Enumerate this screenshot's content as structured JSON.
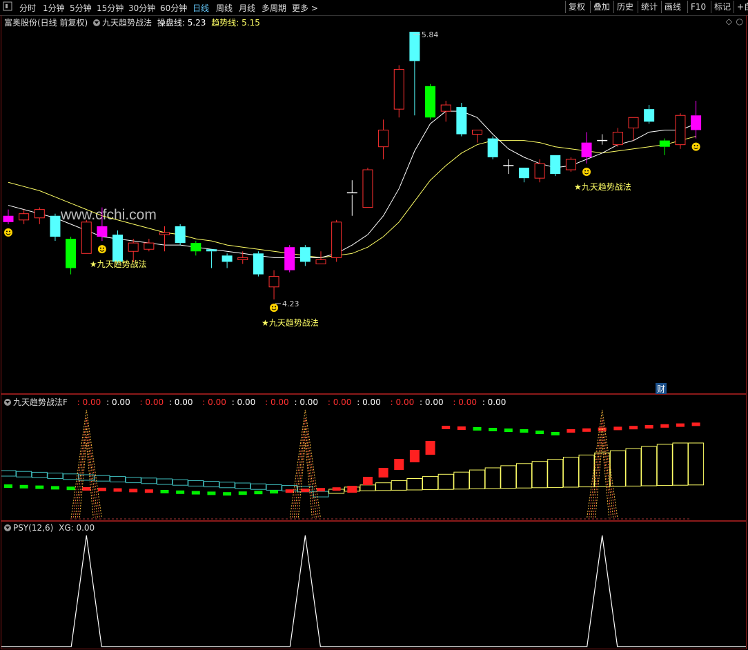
{
  "toolbar": {
    "menu_icon": "menu-icon",
    "periods": [
      "分时",
      "1分钟",
      "5分钟",
      "15分钟",
      "30分钟",
      "60分钟",
      "日线",
      "周线",
      "月线",
      "多周期",
      "更多 >"
    ],
    "active_period": "日线",
    "buttons": [
      "复权",
      "叠加",
      "历史",
      "统计",
      "画线",
      "F10",
      "标记",
      "+自"
    ]
  },
  "main_panel": {
    "title_stock": "富奥股份(日线 前复权)",
    "indicator_name": "九天趋势战法",
    "line1_label": "操盘线: 5.23",
    "line2_label": "趋势线: 5.15",
    "watermark": "www.cfchi.com",
    "high_marker": "5.84",
    "low_marker": "4.23",
    "signal_text": "★九天趋势战法",
    "cai_badge": "财",
    "colors": {
      "up_solid": "#ff00ff",
      "up_hollow": "#ff3030",
      "down_solid": "#00ff00",
      "down_cyan": "#55ffff",
      "ma_white": "#ffffff",
      "ma_yellow": "#ffff66"
    }
  },
  "sub1": {
    "title": "九天趋势战法F",
    "values": [
      "0.00",
      "0.00",
      "0.00",
      "0.00",
      "0.00",
      "0.00",
      "0.00",
      "0.00",
      "0.00",
      "0.00",
      "0.00",
      "0.00",
      "0.00",
      "0.00"
    ]
  },
  "sub2": {
    "title": "PSY(12,6)",
    "xg_label": "XG: 0.00"
  },
  "chart_data": {
    "type": "candlestick",
    "price_range": [
      4.23,
      5.84
    ],
    "candles": [
      {
        "o": 4.96,
        "c": 4.93,
        "h": 4.99,
        "l": 4.92,
        "k": "m"
      },
      {
        "o": 4.94,
        "c": 4.97,
        "h": 4.99,
        "l": 4.92,
        "k": "r"
      },
      {
        "o": 4.95,
        "c": 4.99,
        "h": 5.0,
        "l": 4.92,
        "k": "r"
      },
      {
        "o": 4.96,
        "c": 4.86,
        "h": 4.97,
        "l": 4.84,
        "k": "c"
      },
      {
        "o": 4.85,
        "c": 4.71,
        "h": 4.86,
        "l": 4.68,
        "k": "g"
      },
      {
        "o": 4.78,
        "c": 4.93,
        "h": 4.94,
        "l": 4.78,
        "k": "r"
      },
      {
        "o": 4.91,
        "c": 4.86,
        "h": 5.0,
        "l": 4.84,
        "k": "m"
      },
      {
        "o": 4.87,
        "c": 4.74,
        "h": 4.89,
        "l": 4.73,
        "k": "c"
      },
      {
        "o": 4.79,
        "c": 4.83,
        "h": 4.85,
        "l": 4.74,
        "k": "r"
      },
      {
        "o": 4.8,
        "c": 4.83,
        "h": 4.85,
        "l": 4.79,
        "k": "r"
      },
      {
        "o": 4.87,
        "c": 4.88,
        "h": 4.91,
        "l": 4.79,
        "k": "r"
      },
      {
        "o": 4.91,
        "c": 4.83,
        "h": 4.92,
        "l": 4.82,
        "k": "c"
      },
      {
        "o": 4.83,
        "c": 4.79,
        "h": 4.84,
        "l": 4.77,
        "k": "g"
      },
      {
        "o": 4.8,
        "c": 4.79,
        "h": 4.8,
        "l": 4.71,
        "k": "c"
      },
      {
        "o": 4.77,
        "c": 4.74,
        "h": 4.78,
        "l": 4.71,
        "k": "c"
      },
      {
        "o": 4.75,
        "c": 4.76,
        "h": 4.79,
        "l": 4.73,
        "k": "r"
      },
      {
        "o": 4.78,
        "c": 4.68,
        "h": 4.79,
        "l": 4.67,
        "k": "c"
      },
      {
        "o": 4.62,
        "c": 4.67,
        "h": 4.7,
        "l": 4.56,
        "k": "r"
      },
      {
        "o": 4.7,
        "c": 4.81,
        "h": 4.82,
        "l": 4.69,
        "k": "m"
      },
      {
        "o": 4.81,
        "c": 4.74,
        "h": 4.82,
        "l": 4.72,
        "k": "c"
      },
      {
        "o": 4.73,
        "c": 4.75,
        "h": 4.79,
        "l": 4.73,
        "k": "r"
      },
      {
        "o": 4.76,
        "c": 4.93,
        "h": 4.94,
        "l": 4.74,
        "k": "r"
      },
      {
        "o": 5.06,
        "c": 5.07,
        "h": 5.13,
        "l": 4.96,
        "k": "w"
      },
      {
        "o": 5.0,
        "c": 5.18,
        "h": 5.19,
        "l": 5.0,
        "k": "r"
      },
      {
        "o": 5.29,
        "c": 5.37,
        "h": 5.42,
        "l": 5.23,
        "k": "r"
      },
      {
        "o": 5.47,
        "c": 5.66,
        "h": 5.68,
        "l": 5.43,
        "k": "r"
      },
      {
        "o": 5.7,
        "c": 5.84,
        "h": 5.84,
        "l": 5.44,
        "k": "c"
      },
      {
        "o": 5.58,
        "c": 5.43,
        "h": 5.59,
        "l": 5.42,
        "k": "g"
      },
      {
        "o": 5.46,
        "c": 5.49,
        "h": 5.51,
        "l": 5.41,
        "k": "r"
      },
      {
        "o": 5.48,
        "c": 5.35,
        "h": 5.5,
        "l": 5.34,
        "k": "c"
      },
      {
        "o": 5.35,
        "c": 5.37,
        "h": 5.37,
        "l": 5.31,
        "k": "r"
      },
      {
        "o": 5.33,
        "c": 5.24,
        "h": 5.34,
        "l": 5.23,
        "k": "c"
      },
      {
        "o": 5.2,
        "c": 5.2,
        "h": 5.23,
        "l": 5.16,
        "k": "w"
      },
      {
        "o": 5.19,
        "c": 5.14,
        "h": 5.19,
        "l": 5.12,
        "k": "c"
      },
      {
        "o": 5.14,
        "c": 5.21,
        "h": 5.23,
        "l": 5.12,
        "k": "r"
      },
      {
        "o": 5.16,
        "c": 5.25,
        "h": 5.25,
        "l": 5.15,
        "k": "c"
      },
      {
        "o": 5.18,
        "c": 5.23,
        "h": 5.24,
        "l": 5.17,
        "k": "r"
      },
      {
        "o": 5.24,
        "c": 5.31,
        "h": 5.36,
        "l": 5.21,
        "k": "m"
      },
      {
        "o": 5.32,
        "c": 5.32,
        "h": 5.35,
        "l": 5.3,
        "k": "w"
      },
      {
        "o": 5.3,
        "c": 5.36,
        "h": 5.38,
        "l": 5.29,
        "k": "r"
      },
      {
        "o": 5.38,
        "c": 5.43,
        "h": 5.43,
        "l": 5.32,
        "k": "r"
      },
      {
        "o": 5.41,
        "c": 5.47,
        "h": 5.49,
        "l": 5.4,
        "k": "c"
      },
      {
        "o": 5.32,
        "c": 5.29,
        "h": 5.33,
        "l": 5.25,
        "k": "g"
      },
      {
        "o": 5.3,
        "c": 5.44,
        "h": 5.45,
        "l": 5.28,
        "k": "r"
      },
      {
        "o": 5.44,
        "c": 5.37,
        "h": 5.51,
        "l": 5.33,
        "k": "m"
      }
    ],
    "ma_white": [
      5.01,
      4.99,
      4.97,
      4.95,
      4.92,
      4.89,
      4.86,
      4.85,
      4.84,
      4.83,
      4.82,
      4.82,
      4.81,
      4.8,
      4.79,
      4.78,
      4.77,
      4.76,
      4.76,
      4.76,
      4.76,
      4.78,
      4.82,
      4.87,
      4.96,
      5.09,
      5.27,
      5.4,
      5.46,
      5.46,
      5.43,
      5.35,
      5.28,
      5.24,
      5.21,
      5.19,
      5.2,
      5.23,
      5.26,
      5.3,
      5.32,
      5.36,
      5.37,
      5.37,
      5.4
    ],
    "ma_yellow": [
      5.12,
      5.1,
      5.08,
      5.05,
      5.02,
      4.99,
      4.96,
      4.94,
      4.92,
      4.9,
      4.88,
      4.87,
      4.85,
      4.84,
      4.82,
      4.81,
      4.8,
      4.79,
      4.78,
      4.77,
      4.76,
      4.77,
      4.78,
      4.81,
      4.86,
      4.93,
      5.03,
      5.13,
      5.2,
      5.26,
      5.3,
      5.32,
      5.32,
      5.32,
      5.31,
      5.29,
      5.28,
      5.27,
      5.26,
      5.27,
      5.28,
      5.29,
      5.3,
      5.32,
      5.34
    ],
    "signals_at": [
      0,
      6,
      17,
      37,
      44
    ],
    "signal_labels_at": [
      6,
      17,
      37
    ]
  }
}
